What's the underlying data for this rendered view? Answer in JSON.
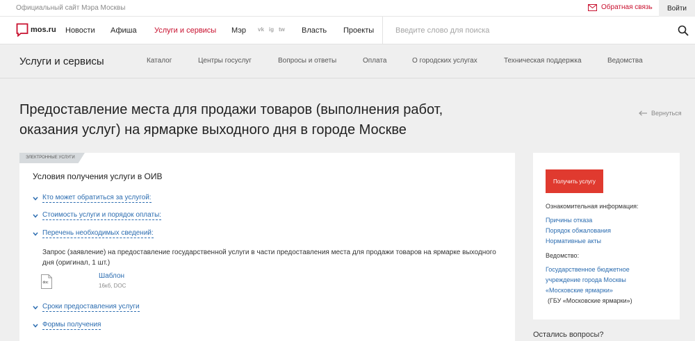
{
  "topbar": {
    "official": "Официальный сайт Мэра Москвы",
    "feedback": "Обратная связь",
    "login": "Войти"
  },
  "header": {
    "logo_text": "mos.ru",
    "nav": [
      "Новости",
      "Афиша",
      "Услуги и сервисы",
      "Мэр",
      "Власть",
      "Проекты"
    ],
    "social": [
      "vk",
      "ig",
      "tw"
    ],
    "search_placeholder": "Введите слово для поиска"
  },
  "subnav": {
    "title": "Услуги и сервисы",
    "items": [
      "Каталог",
      "Центры госуслуг",
      "Вопросы и ответы",
      "Оплата",
      "О городских услугах",
      "Техническая поддержка",
      "Ведомства"
    ]
  },
  "page": {
    "title_line1": "Предоставление места для продажи товаров (выполнения работ,",
    "title_line2": "оказания услуг) на ярмарке выходного дня в городе Москве",
    "back": "Вернуться"
  },
  "card": {
    "tag": "Электронные услуги",
    "heading": "Условия получения услуги в ОИВ",
    "accordion": [
      "Кто может обратиться за услугой:",
      "Стоимость услуги и порядок оплаты:",
      "Перечень необходимых сведений:",
      "Сроки предоставления услуги",
      "Формы получения"
    ],
    "req_line1": "Запрос (заявление) на предоставление государственной услуги в части предоставления места для продажи товаров на ярмарке выходного",
    "req_line2": "дня (оригинал, 1 шт.)",
    "doc_badge": "doc",
    "template_link": "Шаблон",
    "template_meta": "16кб, DOC"
  },
  "sidebar": {
    "button": "Получить услугу",
    "info_label": "Ознакомительная информация:",
    "info_links": [
      "Причины отказа",
      "Порядок обжалования",
      "Нормативные акты"
    ],
    "dept_label": "Ведомство:",
    "dept_lines": [
      "Государственное бюджетное",
      "учреждение города Москвы",
      "«Московские ярмарки»"
    ],
    "dept_short": "(ГБУ «Московские ярмарки»)",
    "questions": "Остались вопросы?"
  },
  "colors": {
    "accent": "#c8102e",
    "button": "#e03a2f",
    "link": "#2b6cb0",
    "background": "#efefef"
  }
}
